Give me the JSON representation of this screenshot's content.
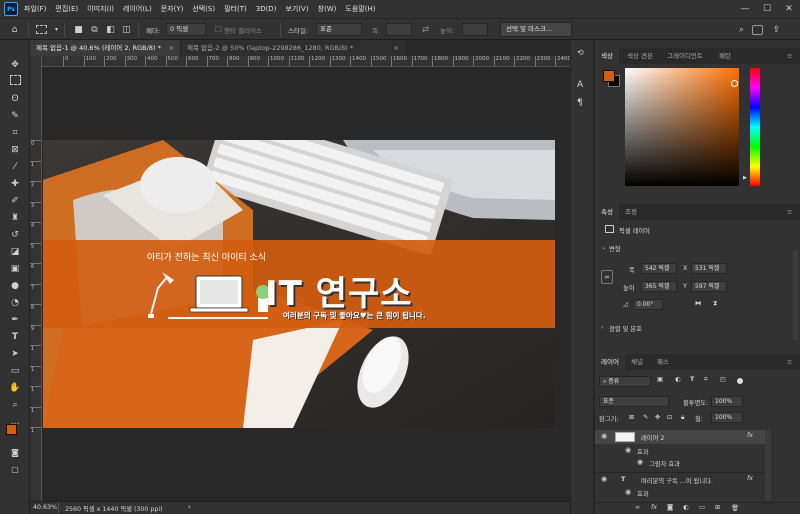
{
  "app": {
    "logo": "Ps",
    "menu": [
      "파일(F)",
      "편집(E)",
      "이미지(I)",
      "레이어(L)",
      "문자(Y)",
      "선택(S)",
      "필터(T)",
      "3D(D)",
      "보기(V)",
      "창(W)",
      "도움말(H)"
    ]
  },
  "options": {
    "feather_label": "페더:",
    "feather_value": "0 픽셀",
    "antialias_label": "앤티 앨리어스",
    "style_label": "스타일:",
    "style_value": "표준",
    "width_label": "폭:",
    "height_label": "높이:",
    "select_mask_button": "선택 및 마스크..."
  },
  "tabs": [
    {
      "label": "제목 없음-1 @ 40.6% (레이어 2, RGB/8) *",
      "close": "×"
    },
    {
      "label": "제목 없음-2 @ 50% (laptop-2298286_1280, RGB/8) *",
      "close": "×"
    }
  ],
  "ruler": {
    "top": [
      "0",
      "100",
      "200",
      "300",
      "400",
      "500",
      "600",
      "700",
      "800",
      "900",
      "1000",
      "1100",
      "1200",
      "1300",
      "1400",
      "1500",
      "1600",
      "1700",
      "1800",
      "1900",
      "2000",
      "2100",
      "2200",
      "2300",
      "2400",
      "2500"
    ],
    "left": [
      "0",
      "1",
      "2",
      "3",
      "4",
      "5",
      "6",
      "7",
      "8",
      "9",
      "1",
      "1",
      "1",
      "1",
      "1"
    ]
  },
  "canvas": {
    "tagline": "아티가 전하는 최신 아이티 소식",
    "title": "IT 연구소",
    "subtitle": "여러분의 구독 및 좋아요♥는 큰 힘이 됩니다.",
    "banner_color": "#d35d10"
  },
  "status": {
    "zoom": "40.63%",
    "doc_size": "2560 픽셀 x 1440 픽셀 (300 ppi)"
  },
  "colors": {
    "foreground": "#d35d10",
    "background": "#000000"
  },
  "color_panel": {
    "tabs": [
      "색상",
      "색상 견본",
      "그레이디언트",
      "패턴"
    ]
  },
  "properties": {
    "tabs": [
      "속성",
      "조정"
    ],
    "layer_type": "픽셀 레이어",
    "transform_title": "변형",
    "w_label": "폭",
    "w_value": "542 픽셀",
    "x_label": "X",
    "x_value": "531 픽셀",
    "h_label": "높이",
    "h_value": "365 픽셀",
    "y_label": "Y",
    "y_value": "597 픽셀",
    "angle_value": "0.00°",
    "align_title": "정렬 및 분포"
  },
  "layers_panel": {
    "tabs": [
      "레이어",
      "채널",
      "패스"
    ],
    "filter_label": "종류",
    "blend_mode": "표준",
    "opacity_label": "불투명도:",
    "opacity_value": "100%",
    "lock_label": "잠그기:",
    "fill_label": "칠:",
    "fill_value": "100%",
    "rows": [
      {
        "name": "레이어 2",
        "fx": "fx"
      },
      {
        "name": "효과"
      },
      {
        "name": "그림자 효과"
      },
      {
        "name": "여러분의 구독 ...이 됩니다.",
        "fx": "fx"
      },
      {
        "name": "효과"
      }
    ]
  }
}
